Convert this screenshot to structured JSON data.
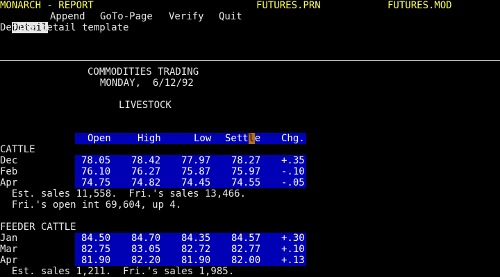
{
  "header": {
    "app_title": "MONARCH - REPORT",
    "file_prn": "FUTURES.PRN",
    "file_mod": "FUTURES.MOD"
  },
  "menu": {
    "items": [
      "Detail",
      "Append",
      "GoTo-Page",
      "Verify",
      "Quit"
    ],
    "active": "Detail",
    "help": "Define detail template"
  },
  "report": {
    "title": "COMMODITIES TRADING",
    "date": "MONDAY,  6/12/92",
    "section": "LIVESTOCK",
    "columns": [
      "Open",
      "High",
      "Low",
      "Settle",
      "Chg."
    ],
    "column_settle_left": "Sett",
    "column_settle_cursor": "l",
    "column_settle_right": "e",
    "groups": [
      {
        "name": "CATTLE",
        "rows": [
          {
            "month": "Dec",
            "open": "78.05",
            "high": "78.42",
            "low": "77.97",
            "settle": "78.27",
            "chg": "+.35"
          },
          {
            "month": "Feb",
            "open": "76.10",
            "high": "76.27",
            "low": "75.87",
            "settle": "75.97",
            "chg": "-.10"
          },
          {
            "month": "Apr",
            "open": "74.75",
            "high": "74.82",
            "low": "74.45",
            "settle": "74.55",
            "chg": "-.05"
          }
        ],
        "notes": [
          "  Est. sales 11,558.  Fri.'s sales 13,466.",
          "  Fri.'s open int 69,604, up 4."
        ]
      },
      {
        "name": "FEEDER CATTLE",
        "rows": [
          {
            "month": "Jan",
            "open": "84.50",
            "high": "84.70",
            "low": "84.35",
            "settle": "84.57",
            "chg": "+.30"
          },
          {
            "month": "Mar",
            "open": "82.75",
            "high": "83.05",
            "low": "82.72",
            "settle": "82.77",
            "chg": "+.10"
          },
          {
            "month": "Apr",
            "open": "81.90",
            "high": "82.20",
            "low": "81.90",
            "settle": "82.00",
            "chg": "+.13"
          }
        ],
        "notes": [
          "  Est. sales 1,211.  Fri.'s sales 1,985."
        ]
      }
    ]
  }
}
